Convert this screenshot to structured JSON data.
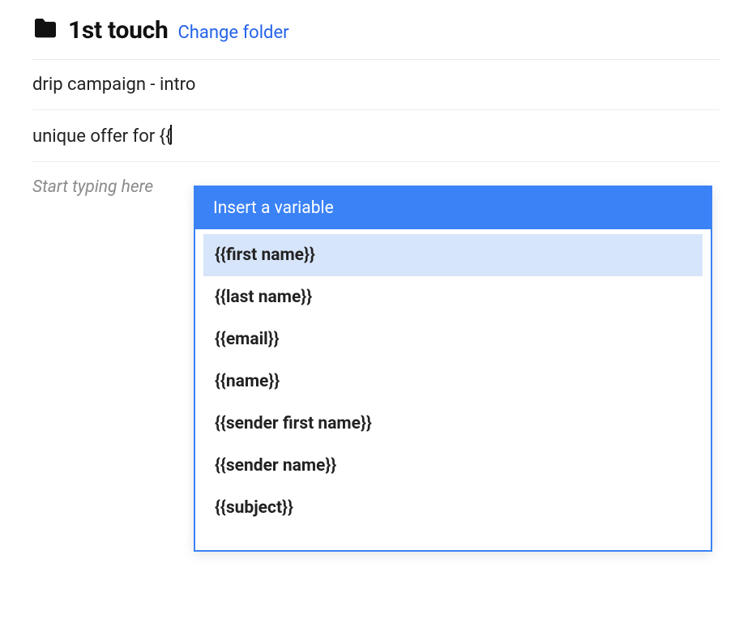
{
  "header": {
    "folder_title": "1st touch",
    "change_folder_label": "Change folder"
  },
  "campaign": {
    "name": "drip campaign - intro"
  },
  "subject": {
    "value": "unique offer for {{"
  },
  "body": {
    "placeholder": "Start typing here"
  },
  "variable_dropdown": {
    "title": "Insert a variable",
    "highlighted_index": 0,
    "options": [
      "{{first name}}",
      "{{last name}}",
      "{{email}}",
      "{{name}}",
      "{{sender first name}}",
      "{{sender name}}",
      "{{subject}}"
    ]
  }
}
